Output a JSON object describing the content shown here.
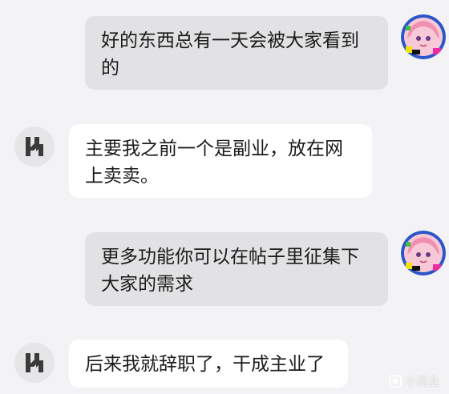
{
  "messages": [
    {
      "sender": "user",
      "text": "好的东西总有一天会被大家看到的"
    },
    {
      "sender": "bot",
      "text": "主要我之前一个是副业，放在网上卖卖。"
    },
    {
      "sender": "user",
      "text": "更多功能你可以在帖子里征集下大家的需求"
    },
    {
      "sender": "bot",
      "text": "后来我就辞职了，干成主业了"
    }
  ],
  "watermark": {
    "text": "小黑盒"
  },
  "colors": {
    "background": "#f3f3f5",
    "outgoing_bubble": "#e2e2e4",
    "incoming_bubble": "#ffffff",
    "text": "#1a1a1a"
  }
}
